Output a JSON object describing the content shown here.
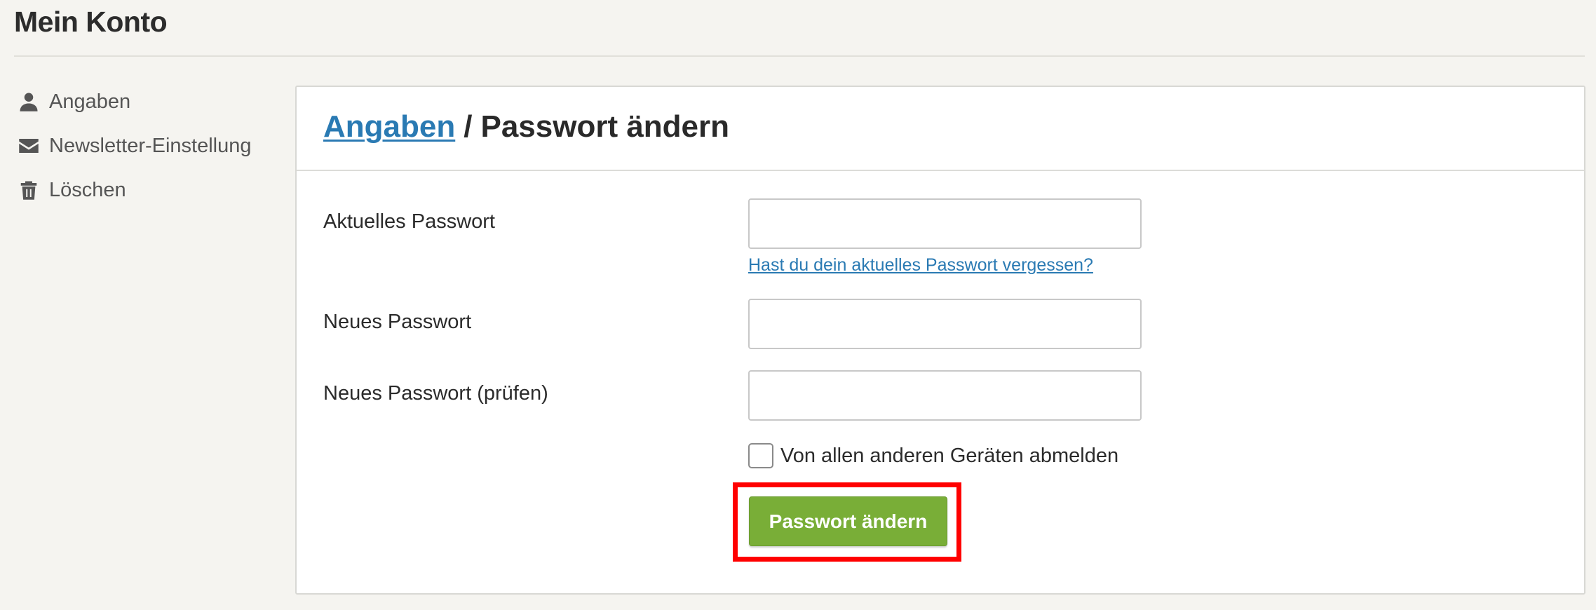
{
  "page": {
    "title": "Mein Konto"
  },
  "sidebar": {
    "items": [
      {
        "label": "Angaben",
        "icon": "user-icon"
      },
      {
        "label": "Newsletter-Einstellung",
        "icon": "envelope-icon"
      },
      {
        "label": "Löschen",
        "icon": "trash-icon"
      }
    ]
  },
  "card": {
    "breadcrumb_link": "Angaben",
    "breadcrumb_separator": "/",
    "breadcrumb_current": "Passwort ändern"
  },
  "form": {
    "current_password_label": "Aktuelles Passwort",
    "current_password_value": "",
    "forgot_link": "Hast du dein aktuelles Passwort vergessen?",
    "new_password_label": "Neues Passwort",
    "new_password_value": "",
    "confirm_password_label": "Neues Passwort (prüfen)",
    "confirm_password_value": "",
    "logout_checkbox_label": "Von allen anderen Geräten abmelden",
    "logout_checkbox_checked": false,
    "submit_label": "Passwort ändern"
  },
  "colors": {
    "background": "#f5f4f0",
    "link": "#2a7ab3",
    "submit_button": "#79ae37",
    "highlight_border": "#ff0000"
  }
}
